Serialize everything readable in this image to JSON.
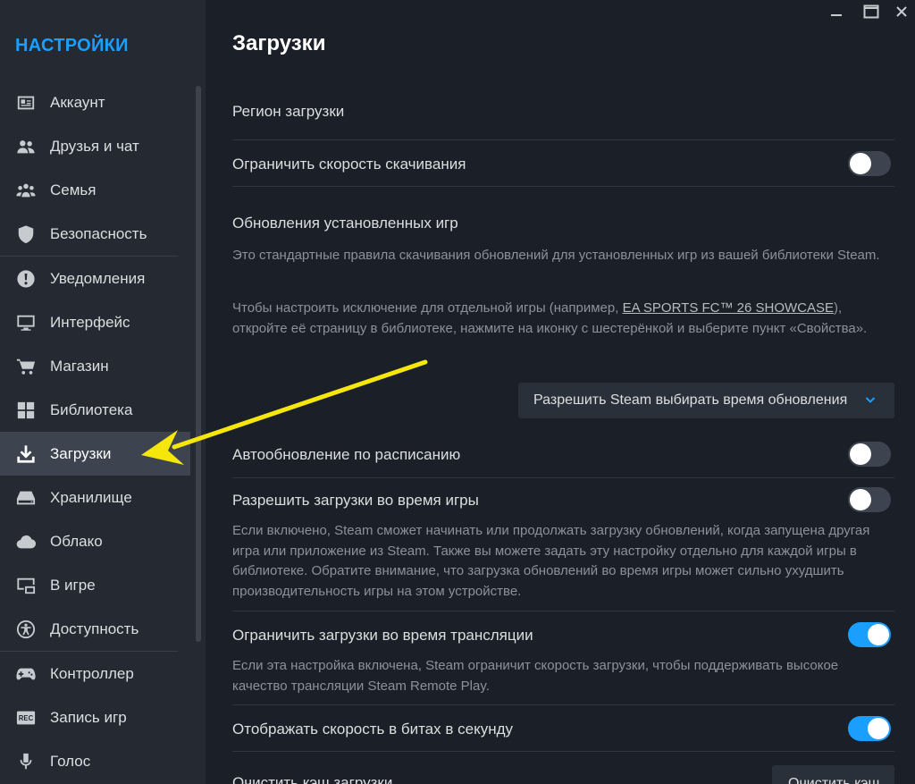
{
  "sidebar": {
    "title": "НАСТРОЙКИ",
    "items": [
      {
        "label": "Аккаунт",
        "icon": "account-card-icon"
      },
      {
        "label": "Друзья и чат",
        "icon": "friends-icon"
      },
      {
        "label": "Семья",
        "icon": "family-icon"
      },
      {
        "label": "Безопасность",
        "icon": "shield-icon"
      },
      {
        "label": "Уведомления",
        "icon": "notification-icon"
      },
      {
        "label": "Интерфейс",
        "icon": "monitor-icon"
      },
      {
        "label": "Магазин",
        "icon": "cart-icon"
      },
      {
        "label": "Библиотека",
        "icon": "grid-icon"
      },
      {
        "label": "Загрузки",
        "icon": "download-icon",
        "active": true
      },
      {
        "label": "Хранилище",
        "icon": "drive-icon"
      },
      {
        "label": "Облако",
        "icon": "cloud-icon"
      },
      {
        "label": "В игре",
        "icon": "ingame-icon"
      },
      {
        "label": "Доступность",
        "icon": "accessibility-icon"
      },
      {
        "label": "Контроллер",
        "icon": "gamepad-icon"
      },
      {
        "label": "Запись игр",
        "icon": "rec-icon"
      },
      {
        "label": "Голос",
        "icon": "microphone-icon"
      }
    ]
  },
  "main": {
    "title": "Загрузки",
    "region_label": "Регион загрузки",
    "limit_speed": {
      "label": "Ограничить скорость скачивания",
      "enabled": false
    },
    "updates": {
      "heading": "Обновления установленных игр",
      "desc1": "Это стандартные правила скачивания обновлений для установленных игр из вашей библиотеки Steam.",
      "desc2_before": "Чтобы настроить исключение для отдельной игры (например, ",
      "desc2_link": "EA SPORTS FC™ 26 SHOWCASE",
      "desc2_after": "), откройте её страницу в библиотеке, нажмите на иконку с шестерёнкой и выберите пункт «Свойства».",
      "dropdown_value": "Разрешить Steam выбирать время обновления"
    },
    "auto_update": {
      "label": "Автообновление по расписанию",
      "enabled": false
    },
    "allow_during_game": {
      "label": "Разрешить загрузки во время игры",
      "enabled": false,
      "desc": "Если включено, Steam сможет начинать или продолжать загрузку обновлений, когда запущена другая игра или приложение из Steam. Также вы можете задать эту настройку отдельно для каждой игры в библиотеке. Обратите внимание, что загрузка обновлений во время игры может сильно ухудшить производительность игры на этом устройстве."
    },
    "limit_streaming": {
      "label": "Ограничить загрузки во время трансляции",
      "enabled": true,
      "desc": "Если эта настройка включена, Steam ограничит скорость загрузки, чтобы поддерживать высокое качество трансляции Steam Remote Play."
    },
    "bits_per_second": {
      "label": "Отображать скорость в битах в секунду",
      "enabled": true
    },
    "clear_cache": {
      "label": "Очистить кэш загрузки",
      "button": "Очистить кэш"
    }
  },
  "colors": {
    "accent": "#1a9fff",
    "arrow": "#f5e60c",
    "bg": "#1b1f27",
    "sidebar": "#242932"
  }
}
